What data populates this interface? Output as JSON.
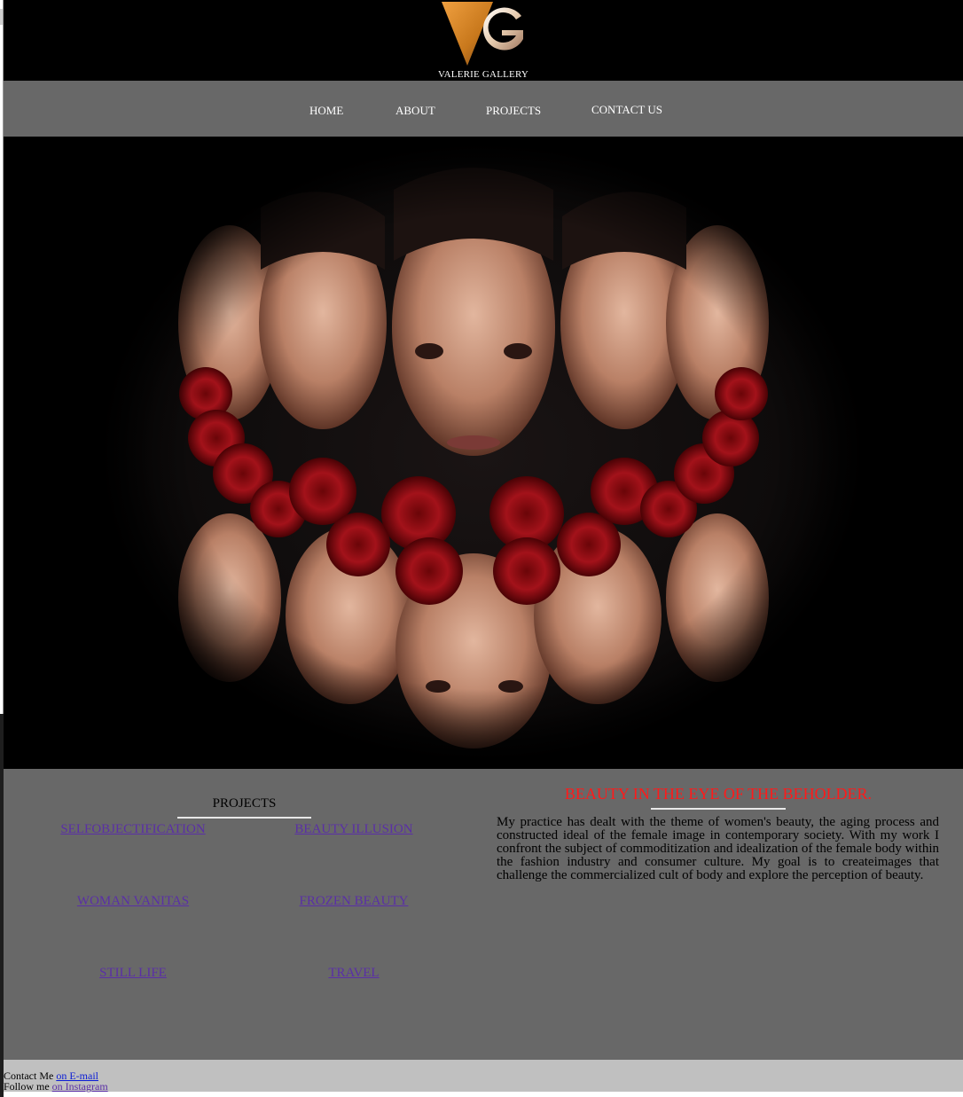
{
  "brand": {
    "logo_icon": "vg-monogram-icon",
    "name": "VALERIE GALLERY",
    "colors": {
      "triangle": "#e08a1e",
      "g_letter": "#f2d9b8"
    }
  },
  "nav": {
    "items": [
      {
        "label": "HOME"
      },
      {
        "label": "ABOUT"
      },
      {
        "label": "PROJECTS"
      },
      {
        "label": "CONTACT US"
      }
    ]
  },
  "hero": {
    "image": "kaleidoscope-portrait-with-red-roses",
    "colors": {
      "background": "#000000",
      "roses": "#8c0a0e"
    }
  },
  "projects": {
    "heading": "PROJECTS",
    "links": [
      {
        "label": "SELFOBJECTIFICATION"
      },
      {
        "label": "BEAUTY ILLUSION"
      },
      {
        "label": "WOMAN VANITAS"
      },
      {
        "label": "FROZEN BEAUTY"
      },
      {
        "label": "STILL LIFE"
      },
      {
        "label": "TRAVEL"
      }
    ]
  },
  "article": {
    "title": "BEAUTY IN THE EYE OF THE BEHOLDER.",
    "body": "My practice has dealt with the theme of women's beauty, the aging process and constructed ideal of the female image in contemporary society. With my work I confront the subject of commoditization and idealization of the female body within the fashion industry and consumer culture. My goal is to createimages that challenge the commercialized cult of body and explore the perception of beauty."
  },
  "footer": {
    "contact_prefix": "Contact Me",
    "contact_link": "on E-mail",
    "follow_prefix": "Follow me",
    "follow_link": "on Instagram"
  },
  "colors": {
    "header_bg": "#000000",
    "nav_bg": "#686868",
    "content_bg": "#686868",
    "footer_bg": "#c0c0c0",
    "link": "#5a2fa6",
    "title_red": "#ff1a1a"
  }
}
